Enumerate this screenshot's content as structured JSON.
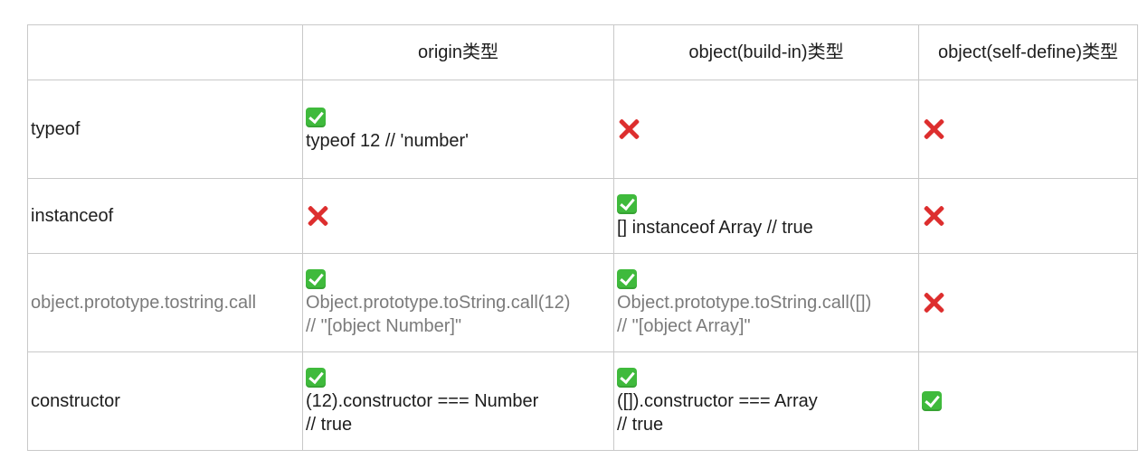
{
  "header": {
    "empty": "",
    "col1": "origin类型",
    "col2": "object(build-in)类型",
    "col3": "object(self-define)类型"
  },
  "rows": [
    {
      "label": "typeof",
      "cells": [
        {
          "mark": "check-icon",
          "lines": [
            "typeof 12 // 'number'"
          ]
        },
        {
          "mark": "cross-icon",
          "lines": []
        },
        {
          "mark": "cross-icon",
          "lines": []
        }
      ]
    },
    {
      "label": "instanceof",
      "cells": [
        {
          "mark": "cross-icon",
          "lines": []
        },
        {
          "mark": "check-icon",
          "lines": [
            "[] instanceof Array // true"
          ]
        },
        {
          "mark": "cross-icon",
          "lines": []
        }
      ]
    },
    {
      "label": "object.prototype.tostring.call",
      "gray": true,
      "cells": [
        {
          "mark": "check-icon",
          "lines": [
            "Object.prototype.toString.call(12)",
            "// \"[object Number]\""
          ]
        },
        {
          "mark": "check-icon",
          "lines": [
            "Object.prototype.toString.call([])",
            "// \"[object Array]\""
          ]
        },
        {
          "mark": "cross-icon",
          "lines": []
        }
      ]
    },
    {
      "label": "constructor",
      "cells": [
        {
          "mark": "check-icon",
          "lines": [
            "(12).constructor === Number",
            "// true"
          ]
        },
        {
          "mark": "check-icon",
          "lines": [
            "([]).constructor === Array",
            "// true"
          ]
        },
        {
          "mark": "check-icon",
          "lines": []
        }
      ]
    }
  ],
  "colors": {
    "check": "#3fba3c",
    "cross": "#dd2e2e",
    "gray_text": "#7b7b7b",
    "border": "#c9c9c9"
  }
}
